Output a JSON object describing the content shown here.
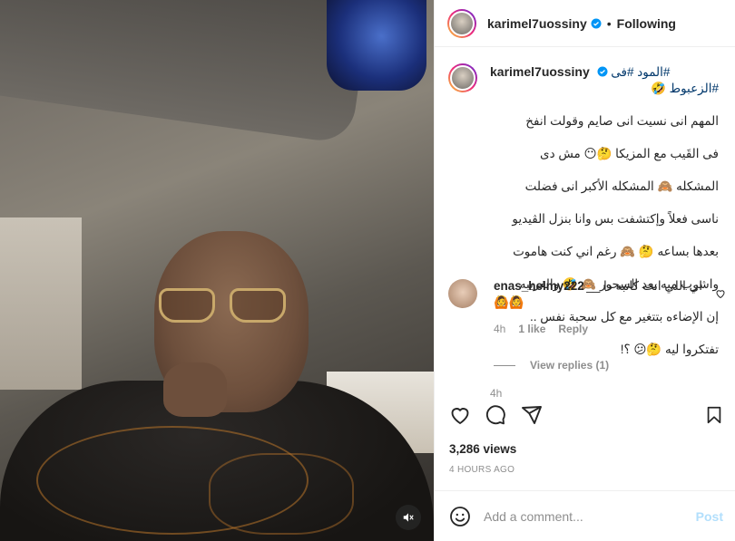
{
  "post": {
    "username": "karimel7uossiny",
    "follow_status": "Following",
    "separator": "•",
    "caption_hashtags": "المود #فى#",
    "caption_hashtag2": "#الزعبوط",
    "caption_emoji1": "🤣",
    "caption_lines": [
      "المهم انى نسيت انى صايم وقولت انفخ",
      "فى القَيب مع المزيكا 🤔😶 مش دى",
      "المشكله 🙈 المشكله الأكبر انى فضلت",
      "ناسى فعلاً وإكتشفت بس وانا بنزل الڤيديو",
      "بعدها بساعه 🤔 🙈 رغم اني كنت هاموت",
      "واشرب ميه بعد السحور 🙈 🤣 والغريبه",
      "إن الإضاءه بتتغير مع كل سحبة نفس ..",
      "تفتكروا ليه 🤔😕 ؟!"
    ],
    "caption_time": "4h",
    "views": "3,286 views",
    "posted_ago": "4 HOURS AGO"
  },
  "comment": {
    "username": "enas_helmy222",
    "text": "اي اللي انت كاتبه دا __",
    "emojis": "🙆🙆",
    "time": "4h",
    "likes": "1 like",
    "reply_label": "Reply",
    "view_replies": "View replies (1)"
  },
  "add_comment": {
    "placeholder": "Add a comment...",
    "post_label": "Post"
  },
  "icons": {
    "verified": "verified-badge-icon",
    "heart": "heart-icon",
    "comment": "comment-icon",
    "share": "share-icon",
    "save": "bookmark-icon",
    "emoji": "emoji-icon",
    "mute": "mute-icon"
  },
  "colors": {
    "verified_blue": "#0095f6",
    "hashtag": "#00376b",
    "meta_gray": "#8e8e8e",
    "post_disabled": "#b2dffc"
  }
}
